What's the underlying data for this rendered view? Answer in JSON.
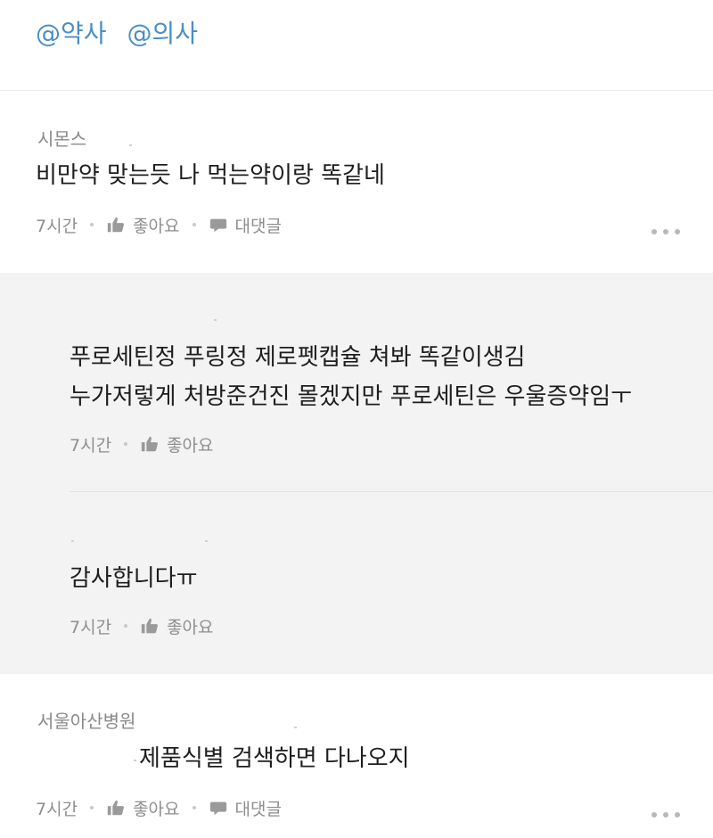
{
  "tags": [
    "@약사",
    "@의사"
  ],
  "comments": [
    {
      "author": "시몬스",
      "text": "비만약 맞는듯 나 먹는약이랑 똑같네",
      "time": "7시간",
      "like_label": "좋아요",
      "reply_label": "대댓글"
    },
    {
      "author": "서울아산병원",
      "text": "제품식별 검색하면 다나오지",
      "time": "7시간",
      "like_label": "좋아요",
      "reply_label": "대댓글"
    }
  ],
  "replies": [
    {
      "lines": [
        "푸로세틴정 푸링정 제로펫캡슐 쳐봐 똑같이생김",
        "누가저렇게 처방준건진 몰겠지만 푸로세틴은 우울증약임ㅜ"
      ],
      "time": "7시간",
      "like_label": "좋아요"
    },
    {
      "text": "감사합니다ㅠ",
      "time": "7시간",
      "like_label": "좋아요"
    }
  ],
  "icons": {
    "like": "thumbs-up-icon",
    "reply": "speech-bubble-icon",
    "more": "more-dots-icon"
  },
  "colors": {
    "tag": "#4a8ec6",
    "reply_background": "#f3f3f3",
    "meta_text": "#8e8e8e"
  }
}
